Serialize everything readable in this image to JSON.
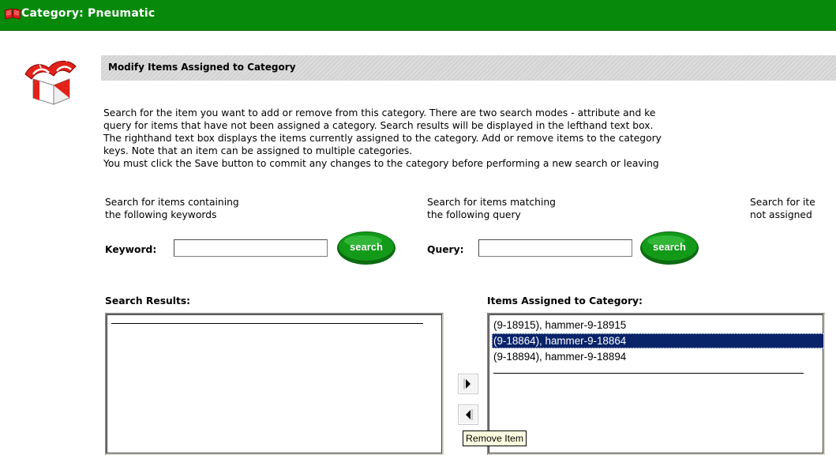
{
  "window": {
    "title": "Category: Pneumatic",
    "title_bar_color": "#078a0c"
  },
  "section": {
    "header": "Modify Items Assigned to Category",
    "icon": "category-box-icon"
  },
  "description": {
    "lines": [
      "Search for the item you want to add or remove from this category. There are two search modes - attribute and ke",
      "query for items that have not been assigned a category. Search results will be displayed in the lefthand text box.",
      "The righthand text box displays the items currently assigned to the category. Add or remove items to the category",
      "keys. Note that an item can be assigned to multiple categories.",
      "You must click the Save button to commit any changes to the category before performing a new search or leaving"
    ]
  },
  "keyword_search": {
    "description_line1": "Search for items containing",
    "description_line2": "the following keywords",
    "label": "Keyword:",
    "value": "",
    "button_label": "search"
  },
  "query_search": {
    "description_line1": "Search for items matching",
    "description_line2": "the following query",
    "label": "Query:",
    "value": "",
    "button_label": "search"
  },
  "unassigned_search": {
    "description_line1": "Search for ite",
    "description_line2": "not assigned"
  },
  "search_results": {
    "header": "Search Results:",
    "items": []
  },
  "assigned_items": {
    "header": "Items Assigned to Category:",
    "items": [
      {
        "label": "(9-18915), hammer-9-18915",
        "selected": false
      },
      {
        "label": "(9-18864), hammer-9-18864",
        "selected": true
      },
      {
        "label": "(9-18894), hammer-9-18894",
        "selected": false
      }
    ]
  },
  "transfer": {
    "add_icon": "arrow-right-icon",
    "remove_icon": "arrow-left-icon"
  },
  "tooltip": {
    "text": "Remove Item"
  },
  "colors": {
    "button_green": "#0f7f14",
    "selection": "#0a246a"
  }
}
